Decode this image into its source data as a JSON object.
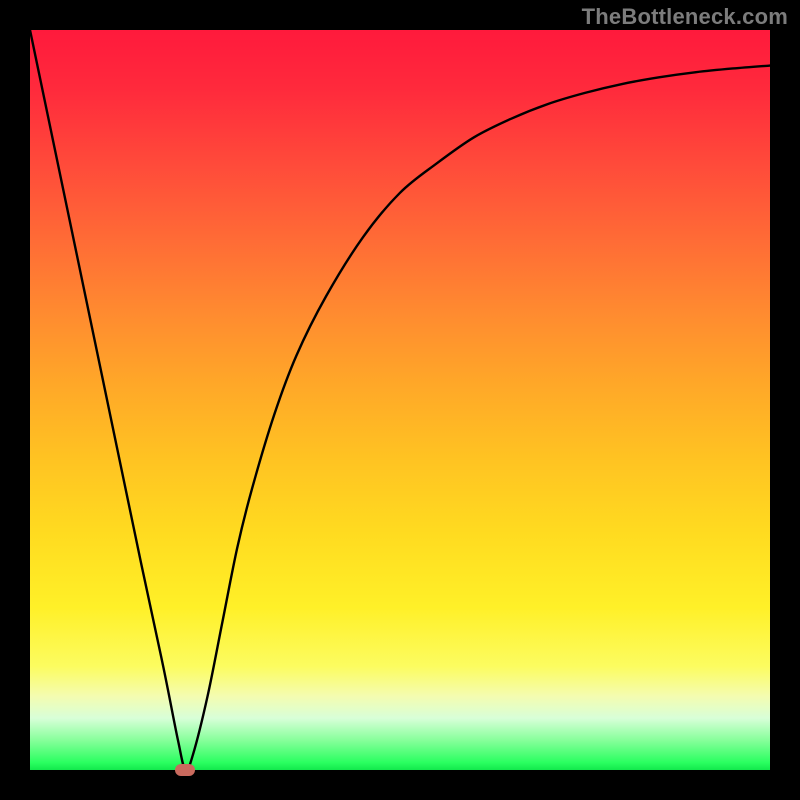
{
  "watermark": "TheBottleneck.com",
  "chart_data": {
    "type": "line",
    "title": "",
    "xlabel": "",
    "ylabel": "",
    "xlim": [
      0,
      100
    ],
    "ylim": [
      0,
      100
    ],
    "grid": false,
    "legend": false,
    "background_gradient_stops": [
      {
        "pct": 0,
        "color": "#ff1a3c"
      },
      {
        "pct": 8,
        "color": "#ff2a3c"
      },
      {
        "pct": 18,
        "color": "#ff4a3a"
      },
      {
        "pct": 28,
        "color": "#ff6a36"
      },
      {
        "pct": 38,
        "color": "#ff8a30"
      },
      {
        "pct": 48,
        "color": "#ffa828"
      },
      {
        "pct": 58,
        "color": "#ffc322"
      },
      {
        "pct": 68,
        "color": "#ffdb20"
      },
      {
        "pct": 78,
        "color": "#fff028"
      },
      {
        "pct": 86,
        "color": "#fcfc60"
      },
      {
        "pct": 90,
        "color": "#f4fcb0"
      },
      {
        "pct": 93,
        "color": "#d8ffd8"
      },
      {
        "pct": 96,
        "color": "#86ff9a"
      },
      {
        "pct": 99,
        "color": "#2aff60"
      },
      {
        "pct": 100,
        "color": "#12e84c"
      }
    ],
    "series": [
      {
        "name": "bottleneck-curve",
        "x": [
          0,
          5,
          10,
          15,
          18,
          20,
          21,
          22,
          24,
          26,
          28,
          30,
          33,
          36,
          40,
          45,
          50,
          55,
          60,
          65,
          70,
          75,
          80,
          85,
          90,
          95,
          100
        ],
        "y": [
          100,
          76,
          52,
          28,
          14,
          4,
          0,
          2,
          10,
          20,
          30,
          38,
          48,
          56,
          64,
          72,
          78,
          82,
          85.5,
          88,
          90,
          91.5,
          92.7,
          93.6,
          94.3,
          94.8,
          95.2
        ]
      }
    ],
    "marker": {
      "name": "optimal-point",
      "x": 21,
      "y": 0,
      "color": "#c96a5e"
    },
    "curve_color": "#000000",
    "curve_width": 2.4
  }
}
